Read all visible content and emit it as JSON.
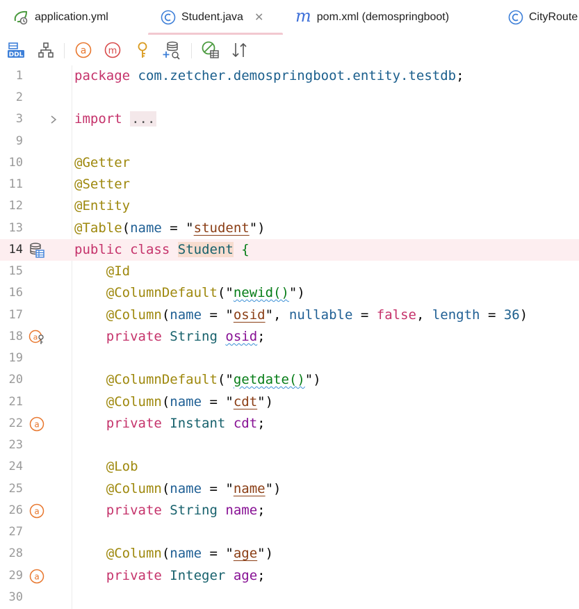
{
  "tabs": [
    {
      "label": "application.yml",
      "icon": "spring-leaf-icon"
    },
    {
      "label": "Student.java",
      "icon": "class-c-icon",
      "active": true,
      "close": "✕"
    },
    {
      "label": "pom.xml (demospringboot)",
      "icon": "maven-m-icon"
    },
    {
      "label": "CityRoute",
      "icon": "class-c-icon"
    }
  ],
  "toolbar": {
    "items": [
      "ddl-icon",
      "hierarchy-icon",
      "attribute-a-icon",
      "method-m-icon",
      "key-icon",
      "add-database-icon",
      "entity-check-icon",
      "sort-icon"
    ],
    "ddl_label": "DDL"
  },
  "editor": {
    "current_line": 14,
    "lines": [
      {
        "n": "1"
      },
      {
        "n": "2"
      },
      {
        "n": "3"
      },
      {
        "n": "9"
      },
      {
        "n": "10"
      },
      {
        "n": "11"
      },
      {
        "n": "12"
      },
      {
        "n": "13"
      },
      {
        "n": "14"
      },
      {
        "n": "15"
      },
      {
        "n": "16"
      },
      {
        "n": "17"
      },
      {
        "n": "18"
      },
      {
        "n": "19"
      },
      {
        "n": "20"
      },
      {
        "n": "21"
      },
      {
        "n": "22"
      },
      {
        "n": "23"
      },
      {
        "n": "24"
      },
      {
        "n": "25"
      },
      {
        "n": "26"
      },
      {
        "n": "27"
      },
      {
        "n": "28"
      },
      {
        "n": "29"
      },
      {
        "n": "30"
      }
    ],
    "tokens": {
      "package_kw": "package",
      "package_name": "com.zetcher.demospringboot.entity.testdb",
      "semicolon": ";",
      "import_kw": "import",
      "import_fold": "...",
      "getter": "@Getter",
      "setter": "@Setter",
      "entity": "@Entity",
      "table": "@Table",
      "name_attr": "name",
      "student_str": "student",
      "public": "public",
      "class": "class",
      "student_cls": "Student",
      "id": "@Id",
      "column_default": "@ColumnDefault",
      "newid": "newid()",
      "column": "@Column",
      "osid": "osid",
      "nullable": "nullable",
      "false": "false",
      "length": "length",
      "len_val": "36",
      "private": "private",
      "string": "String",
      "getdate": "getdate()",
      "cdt": "cdt",
      "instant": "Instant",
      "lob": "@Lob",
      "name_str": "name",
      "integer": "Integer",
      "age": "age"
    }
  }
}
